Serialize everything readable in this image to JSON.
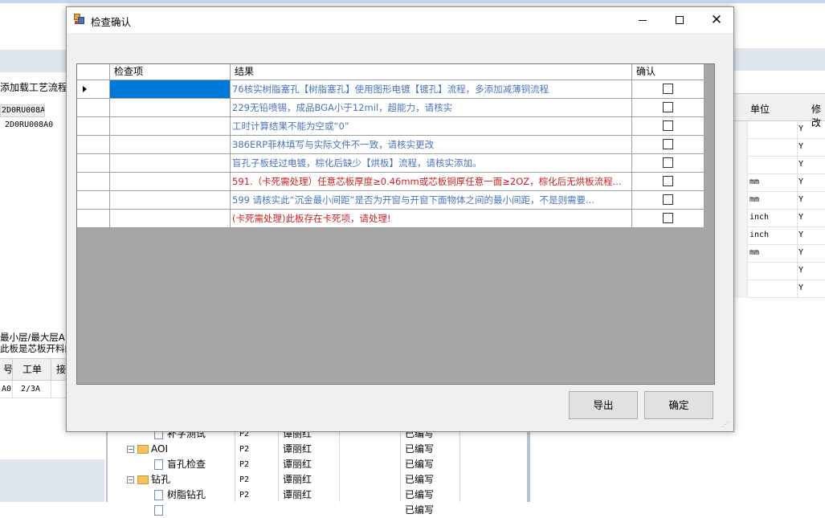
{
  "background": {
    "left_title": "添加载工艺流程",
    "left_tag": "2D0RU008A0",
    "left_tree_item": "2D0RU008A0",
    "left_msg_line1": "最小层/最大层A 加",
    "left_msg_line2": "此板是芯板开料的",
    "left_grid_headers": [
      "号",
      "工单",
      "接"
    ],
    "left_grid_row": [
      "A0",
      "2/3A",
      ""
    ],
    "mid_rows": [
      {
        "name": "补字测试",
        "code": "P2",
        "person": "谭丽红",
        "status": "已编写",
        "type": "doc"
      },
      {
        "name": "AOI",
        "code": "P2",
        "person": "谭丽红",
        "status": "已编写",
        "type": "folder"
      },
      {
        "name": "盲孔检查",
        "code": "P2",
        "person": "谭丽红",
        "status": "已编写",
        "type": "doc"
      },
      {
        "name": "钻孔",
        "code": "P2",
        "person": "谭丽红",
        "status": "已编写",
        "type": "folder"
      },
      {
        "name": "树脂钻孔",
        "code": "P2",
        "person": "谭丽红",
        "status": "已编写",
        "type": "doc"
      },
      {
        "name": "",
        "code": "",
        "person": "",
        "status": "已编写",
        "type": "doc"
      }
    ],
    "right_grid_headers": [
      "单位",
      "修改"
    ],
    "right_grid_rows": [
      {
        "unit": "",
        "flag": "Y"
      },
      {
        "unit": "",
        "flag": "Y"
      },
      {
        "unit": "",
        "flag": "Y"
      },
      {
        "unit": "mm",
        "flag": "Y"
      },
      {
        "unit": "mm",
        "flag": "Y"
      },
      {
        "unit": "inch",
        "flag": "Y"
      },
      {
        "unit": "inch",
        "flag": "Y"
      },
      {
        "unit": "mm",
        "flag": "Y"
      },
      {
        "unit": "",
        "flag": "Y"
      },
      {
        "unit": "",
        "flag": "Y"
      }
    ]
  },
  "dialog": {
    "title": "检查确认",
    "columns": {
      "item": "检查项",
      "result": "结果",
      "confirm": "确认"
    },
    "rows": [
      {
        "item": "",
        "result": "76核实树脂塞孔【树脂塞孔】使用图形电镀【镀孔】流程，多添加减薄铜流程",
        "level": "info",
        "checked": false,
        "selected": true
      },
      {
        "item": "",
        "result": "229无铅喷锡，成品BGA小于12mil，超能力，请核实",
        "level": "info",
        "checked": false,
        "selected": false
      },
      {
        "item": "",
        "result": "工时计算结果不能为空或“0”",
        "level": "info",
        "checked": false,
        "selected": false
      },
      {
        "item": "",
        "result": "386ERP菲林填写与实际文件不一致，请核实更改",
        "level": "info",
        "checked": false,
        "selected": false
      },
      {
        "item": "",
        "result": "盲孔子板经过电镀，棕化后缺少【烘板】流程，请核实添加。",
        "level": "info",
        "checked": false,
        "selected": false
      },
      {
        "item": "",
        "result": "591.（卡死需处理）任意芯板厚度≥0.46mm或芯板铜厚任意一面≥2OZ，棕化后无烘板流程...",
        "level": "error",
        "checked": false,
        "selected": false
      },
      {
        "item": "",
        "result": "599 请核实此“沉金最小间距”是否为开窗与开窗下面物体之间的最小间距，不是则需要...",
        "level": "info",
        "checked": false,
        "selected": false
      },
      {
        "item": "",
        "result": "(卡死需处理)此板存在卡死项，请处理!",
        "level": "error",
        "checked": false,
        "selected": false
      }
    ],
    "buttons": {
      "export": "导出",
      "ok": "确定"
    }
  },
  "colors": {
    "info_text": "#4a74b8",
    "error_text": "#cc1f1f",
    "selection": "#0078d7",
    "grid_empty": "#a6a6a6"
  }
}
